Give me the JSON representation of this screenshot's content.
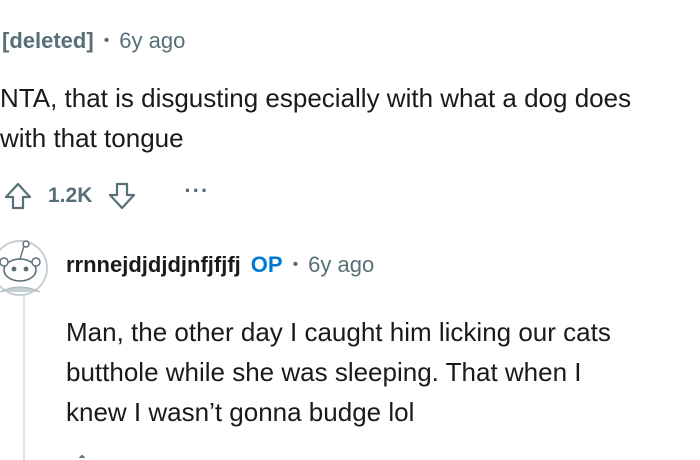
{
  "parent_comment": {
    "author": "[deleted]",
    "separator": "•",
    "age": "6y ago",
    "body_line1": "NTA, that is disgusting especially with what a dog does",
    "body_line2": "with that tongue",
    "score": "1.2K",
    "more_label": "···"
  },
  "reply_comment": {
    "author": "rrnnejdjdjdjnfjfjfj",
    "op_badge": "OP",
    "separator": "•",
    "age": "6y ago",
    "body_line1": "Man, the other day I caught him licking our cats",
    "body_line2": "butthole while she was sleeping. That when I",
    "body_line3": "knew I wasn’t gonna budge lol"
  },
  "icons": {
    "upvote": "upvote-arrow-icon",
    "downvote": "downvote-arrow-icon",
    "more": "more-options-icon",
    "avatar": "snoo-avatar"
  },
  "colors": {
    "meta_gray": "#576f76",
    "text": "#1a1a1b",
    "op_blue": "#0079d3",
    "thread_line": "#dfe3e5"
  }
}
